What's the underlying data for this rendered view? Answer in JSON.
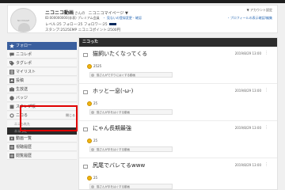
{
  "profile": {
    "avatar_text": "NO IMAGE",
    "name": "ニコニコ動画",
    "san": "さんの",
    "mypage": "ニコニコマイページ ▼",
    "id_line": "ID:000000000(非表) プレミアム会員",
    "id_link": "・ 見ないの登録変更・確認",
    "stats": "レベル:25 フォロー:25 フォロワー:25",
    "points": "スタンプ:2525EMP ニコニコポイント:2500円",
    "account_settings": "▼ アカウント設定",
    "profile_display": "・プロフィールの表示確認/編集"
  },
  "sidebar": {
    "items": [
      {
        "label": "フォロー",
        "icon": "star-icon",
        "active": true
      },
      {
        "label": "ニコレポ",
        "icon": "chat-icon"
      },
      {
        "label": "タグレポ",
        "icon": "tag-icon"
      },
      {
        "label": "マイリスト",
        "icon": "list-icon"
      },
      {
        "label": "投稿",
        "icon": "upload-icon"
      },
      {
        "label": "生放送",
        "icon": "live-icon"
      },
      {
        "label": "バッジ",
        "icon": "badge-icon"
      },
      {
        "label": "スタンプ帳",
        "icon": "stamp-icon"
      }
    ],
    "nikotta": {
      "label": "ニコる",
      "close": "閉じる",
      "sub1": "ニコられた",
      "sub2": "ニコった"
    },
    "rest": [
      {
        "label": "動画一覧",
        "icon": "video-icon"
      },
      {
        "label": "視聴履歴",
        "icon": "history-icon"
      },
      {
        "label": "閲覧履歴",
        "icon": "browse-icon"
      }
    ]
  },
  "main": {
    "header": "ニコった",
    "posts": [
      {
        "title": "猫飼いたくなってくる",
        "date": "2019/8/29 13:00",
        "coins": "2525",
        "comment": "猫さんがですりにはぐする動画"
      },
      {
        "title": "ホッと一息(-ω-)",
        "date": "2019/8/29 13:00",
        "coins": "25",
        "comment": "猫さんが手をはぐする動画"
      },
      {
        "title": "にゃん長期最強",
        "date": "2019/8/29 13:00",
        "coins": "25",
        "comment": "猫さんが手をはぐする動画"
      },
      {
        "title": "尻尾でバレてるwww",
        "date": "2019/8/29 13:00",
        "coins": "25",
        "comment": "猫さんが手をはぐする動画"
      }
    ]
  },
  "colors": {
    "active": "#3a5f9e",
    "highlight": "#e00000",
    "header": "#2d2d2d",
    "coin": "#f1b40f"
  }
}
